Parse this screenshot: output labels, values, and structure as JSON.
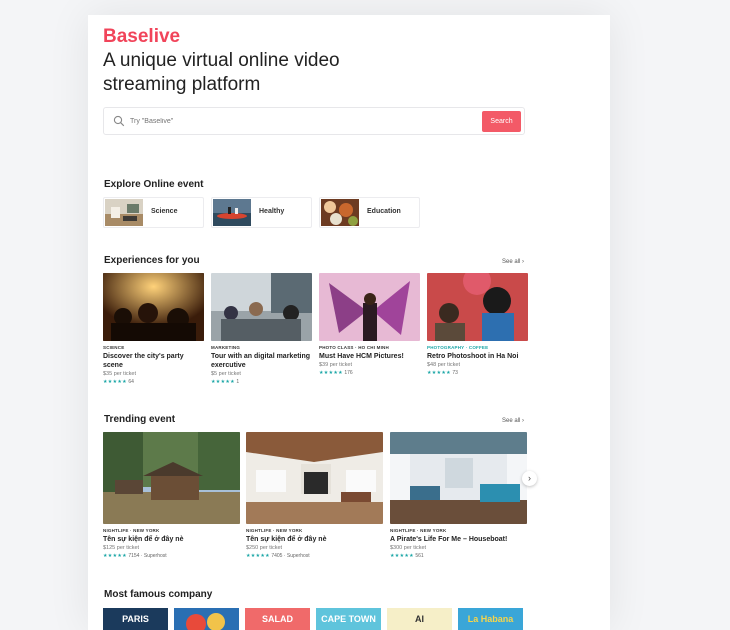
{
  "brand": "Baselive",
  "headline": "A unique virtual online video streaming platform",
  "search": {
    "placeholder": "Try \"Baselive\"",
    "button": "Search"
  },
  "explore": {
    "title": "Explore Online event",
    "categories": [
      {
        "label": "Science"
      },
      {
        "label": "Healthy"
      },
      {
        "label": "Education"
      }
    ]
  },
  "experiences": {
    "title": "Experiences for you",
    "see_all": "See all",
    "cards": [
      {
        "tag": "SCIENCE",
        "title": "Discover the city's party scene",
        "price": "$35 per ticket",
        "stars": "★★★★★",
        "count": "64"
      },
      {
        "tag": "MARKETING",
        "title": "Tour with an digital marketing exercutive",
        "price": "$5 per ticket",
        "stars": "★★★★★",
        "count": "1"
      },
      {
        "tag": "PHOTO CLASS · HO CHI MINH",
        "title": "Must Have HCM Pictures!",
        "price": "$39 per ticket",
        "stars": "★★★★★",
        "count": "176"
      },
      {
        "tag": "PHOTOGRAPHY · COFFEE",
        "title": "Retro Photoshoot in Ha Noi",
        "price": "$48 per ticket",
        "stars": "★★★★★",
        "count": "73"
      }
    ]
  },
  "trending": {
    "title": "Trending event",
    "see_all": "See all",
    "cards": [
      {
        "tag": "NIGHTLIFE · NEW YORK",
        "title": "Tên sự kiện để ở đây nè",
        "price": "$125 per ticket",
        "stars": "★★★★★",
        "count": "7154 · Superhost"
      },
      {
        "tag": "NIGHTLIFE · NEW YORK",
        "title": "Tên sự kiện để ở đây nè",
        "price": "$250 per ticket",
        "stars": "★★★★★",
        "count": "7405 · Superhost"
      },
      {
        "tag": "NIGHTLIFE · NEW YORK",
        "title": "A Pirate's Life For Me – Houseboat!",
        "price": "$300 per ticket",
        "stars": "★★★★★",
        "count": "561"
      }
    ]
  },
  "companies": {
    "title": "Most famous company",
    "items": [
      "PARIS",
      "",
      "SALAD",
      "CAPE TOWN",
      "AI",
      "La Habana"
    ]
  },
  "colors": {
    "brand": "#f1445a",
    "accent": "#1aa6a6",
    "search_btn": "#f35a67"
  }
}
